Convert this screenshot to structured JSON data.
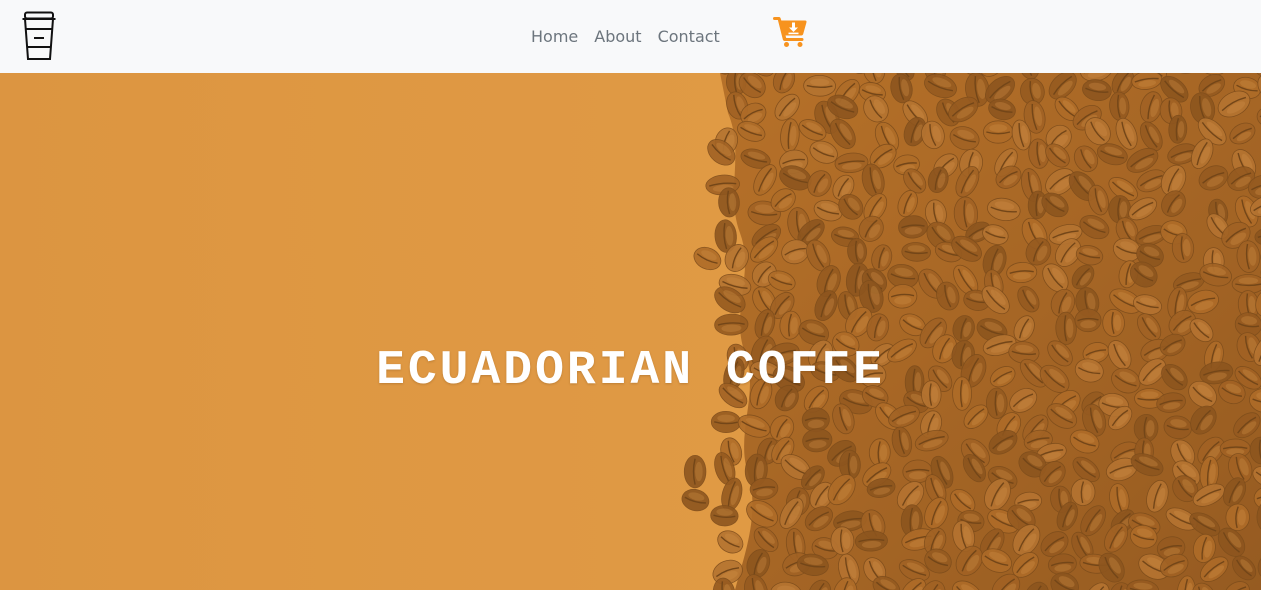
{
  "navbar": {
    "logo_icon": "coffee-cup-icon",
    "links": [
      {
        "label": "Home"
      },
      {
        "label": "About"
      },
      {
        "label": "Contact"
      }
    ],
    "cart_icon": "cart-download-icon",
    "accent_color": "#f7931e",
    "background_color": "#f8f9fa"
  },
  "hero": {
    "title": "ECUADORIAN  COFFE",
    "overlay_color": "#e09a45",
    "image_subject": "coffee-beans"
  }
}
